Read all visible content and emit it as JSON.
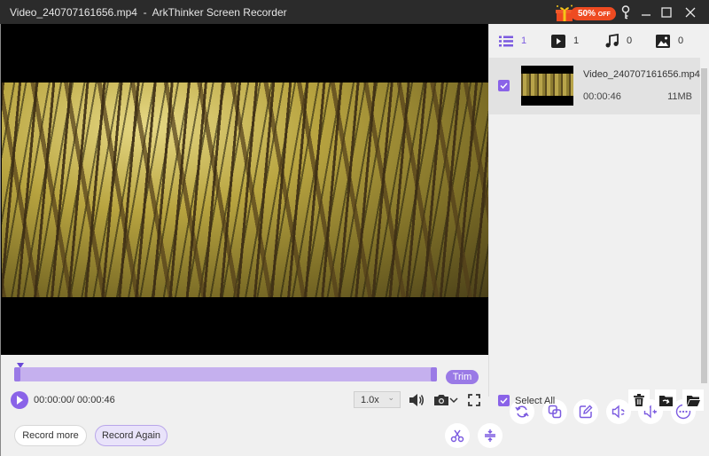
{
  "window": {
    "title": "Video_240707161656.mp4  -  ArkThinker Screen Recorder",
    "promo": {
      "percent": "50%",
      "suffix": "OFF"
    },
    "buttons": [
      "key",
      "minimize",
      "maximize",
      "close"
    ]
  },
  "player": {
    "trim_label": "Trim",
    "current_time": "00:00:00",
    "total_time": "00:00:46",
    "time_display": "00:00:00/ 00:00:46",
    "speed": "1.0x",
    "progress": 0.0
  },
  "actions": {
    "record_more": "Record more",
    "record_again": "Record Again"
  },
  "tools": [
    "trim",
    "merge",
    "convert",
    "compress",
    "edit",
    "audio-convert",
    "audio-boost",
    "more"
  ],
  "sidebar": {
    "filters": [
      {
        "name": "all",
        "count": "1",
        "active": true
      },
      {
        "name": "video",
        "count": "1"
      },
      {
        "name": "audio",
        "count": "0"
      },
      {
        "name": "image",
        "count": "0"
      }
    ],
    "items": [
      {
        "filename": "Video_240707161656.mp4",
        "duration": "00:00:46",
        "size": "11MB",
        "checked": true
      }
    ],
    "select_all_label": "Select All",
    "select_all_checked": true
  },
  "colors": {
    "accent": "#8a63e8",
    "timeline": "#c5b0ee",
    "promo": "#ee4b21"
  }
}
